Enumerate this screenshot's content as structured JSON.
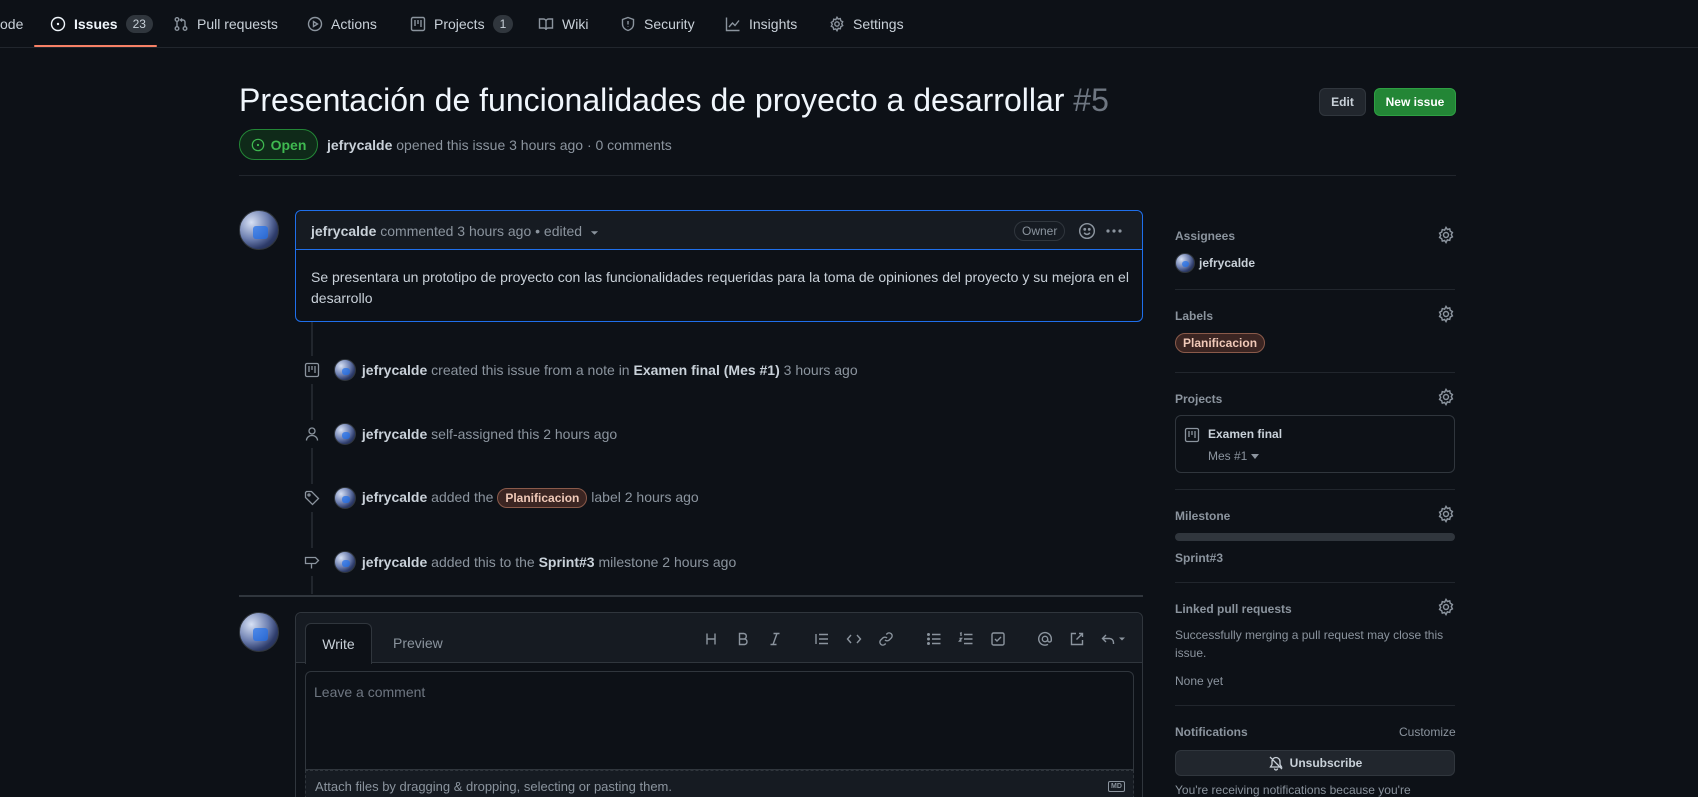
{
  "nav": {
    "code_fragment": "ode",
    "issues_label": "Issues",
    "issues_count": "23",
    "pulls_label": "Pull requests",
    "actions_label": "Actions",
    "projects_label": "Projects",
    "projects_count": "1",
    "wiki_label": "Wiki",
    "security_label": "Security",
    "insights_label": "Insights",
    "settings_label": "Settings"
  },
  "issue": {
    "title": "Presentación de funcionalidades de proyecto a desarrollar",
    "number": "#5",
    "state": "Open",
    "author": "jefrycalde",
    "meta_text": "opened this issue 3 hours ago · 0 comments",
    "edit_label": "Edit",
    "new_issue_label": "New issue"
  },
  "comment": {
    "author": "jefrycalde",
    "meta": "commented 3 hours ago • edited",
    "badge": "Owner",
    "body": "Se presentara un prototipo de proyecto con las funcionalidades requeridas para la toma de opiniones del proyecto y su mejora en el desarrollo"
  },
  "events": [
    {
      "actor": "jefrycalde",
      "text": "created this issue from a note in",
      "target": "Examen final (Mes #1)",
      "time": "3 hours ago"
    },
    {
      "actor": "jefrycalde",
      "text": "self-assigned this",
      "time": "2 hours ago"
    },
    {
      "actor": "jefrycalde",
      "text": "added the",
      "label": "Planificacion",
      "text2": "label",
      "time": "2 hours ago"
    },
    {
      "actor": "jefrycalde",
      "text": "added this to the",
      "target": "Sprint#3",
      "text2": "milestone",
      "time": "2 hours ago"
    }
  ],
  "editor": {
    "tab_write": "Write",
    "tab_preview": "Preview",
    "placeholder": "Leave a comment",
    "attach_hint": "Attach files by dragging & dropping, selecting or pasting them.",
    "md_badge": "MD"
  },
  "sidebar": {
    "assignees_heading": "Assignees",
    "assignee": "jefrycalde",
    "labels_heading": "Labels",
    "label": "Planificacion",
    "projects_heading": "Projects",
    "project_name": "Examen final",
    "project_column": "Mes #1",
    "milestone_heading": "Milestone",
    "milestone_progress": 0,
    "milestone_name": "Sprint#3",
    "linked_heading": "Linked pull requests",
    "linked_desc_1": "Successfully merging a pull request may close this",
    "linked_desc_2": "issue.",
    "linked_none": "None yet",
    "notifications_heading": "Notifications",
    "customize_label": "Customize",
    "unsubscribe_label": "Unsubscribe",
    "notif_reason": "You're receiving notifications because you're"
  },
  "colors": {
    "accent_green": "#238636",
    "open_green": "#3fb950",
    "tab_underline": "#f78166",
    "focus_blue": "#1f6feb"
  }
}
